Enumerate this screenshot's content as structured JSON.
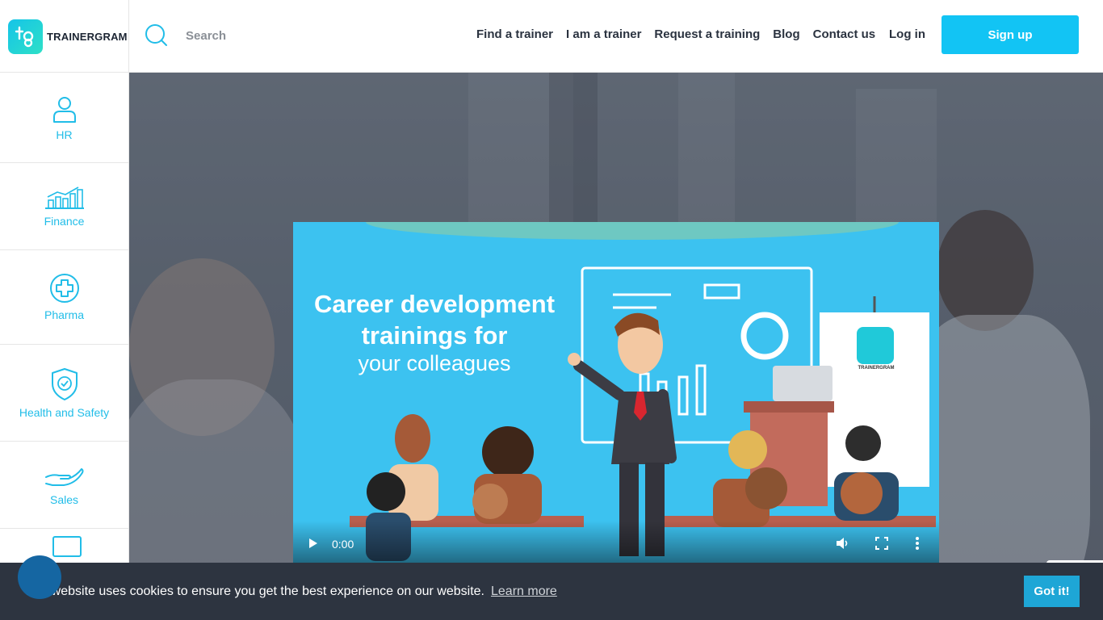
{
  "header": {
    "brand": "TRAINERGRAM",
    "search_placeholder": "Search",
    "nav": [
      "Find a trainer",
      "I am a trainer",
      "Request a training",
      "Blog",
      "Contact us"
    ],
    "login": "Log in",
    "signup": "Sign up"
  },
  "sidebar": {
    "items": [
      {
        "label": "HR",
        "icon": "user-icon"
      },
      {
        "label": "Finance",
        "icon": "chart-icon"
      },
      {
        "label": "Pharma",
        "icon": "medical-cross-icon"
      },
      {
        "label": "Health and Safety",
        "icon": "shield-check-icon"
      },
      {
        "label": "Sales",
        "icon": "hand-icon"
      }
    ]
  },
  "video": {
    "headline": "Career development trainings for",
    "subline": "your colleagues",
    "board_brand": "TRAINERGRAM",
    "time": "0:00"
  },
  "cookie": {
    "message": "This website uses cookies to ensure you get the best experience on our website.",
    "link": "Learn more",
    "button": "Got it!"
  },
  "colors": {
    "accent": "#12c4f4",
    "sidebar_text": "#21bde8",
    "cookie_bg": "#2d3440",
    "cookie_button": "#1ea6d6"
  }
}
